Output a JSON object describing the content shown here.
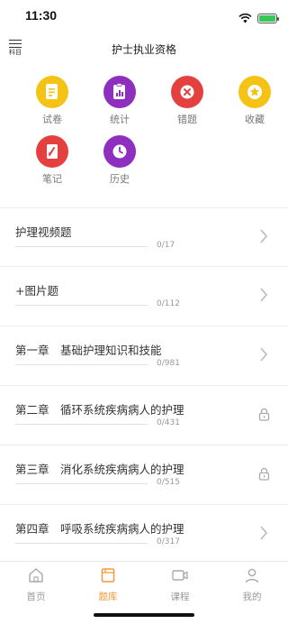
{
  "status_bar": {
    "time": "11:30"
  },
  "header": {
    "menu_label": "科目",
    "title": "护士执业资格"
  },
  "colors": {
    "yellow": "#f5c316",
    "purple": "#8e2fc0",
    "red": "#e54040",
    "accent": "#f39a3a"
  },
  "grid": {
    "row1": [
      {
        "label": "试卷",
        "icon": "exam-paper-icon"
      },
      {
        "label": "统计",
        "icon": "statistics-icon"
      },
      {
        "label": "错题",
        "icon": "wrong-questions-icon"
      },
      {
        "label": "收藏",
        "icon": "favorites-star-icon"
      }
    ],
    "row2": [
      {
        "label": "笔记",
        "icon": "notes-icon"
      },
      {
        "label": "历史",
        "icon": "history-clock-icon"
      }
    ]
  },
  "list": [
    {
      "title": "护理视频题",
      "count": "0/17",
      "right": "chevron"
    },
    {
      "title": "+图片题",
      "count": "0/112",
      "right": "chevron"
    },
    {
      "title": "第一章　基础护理知识和技能",
      "count": "0/981",
      "right": "chevron"
    },
    {
      "title": "第二章　循环系统疾病病人的护理",
      "count": "0/431",
      "right": "lock"
    },
    {
      "title": "第三章　消化系统疾病病人的护理",
      "count": "0/515",
      "right": "lock"
    },
    {
      "title": "第四章　呼吸系统疾病病人的护理",
      "count": "0/317",
      "right": "chevron"
    }
  ],
  "tabbar": {
    "tabs": [
      {
        "label": "首页",
        "icon": "home-icon"
      },
      {
        "label": "题库",
        "icon": "question-bank-icon",
        "active": true
      },
      {
        "label": "课程",
        "icon": "course-video-icon"
      },
      {
        "label": "我的",
        "icon": "profile-icon"
      }
    ]
  }
}
